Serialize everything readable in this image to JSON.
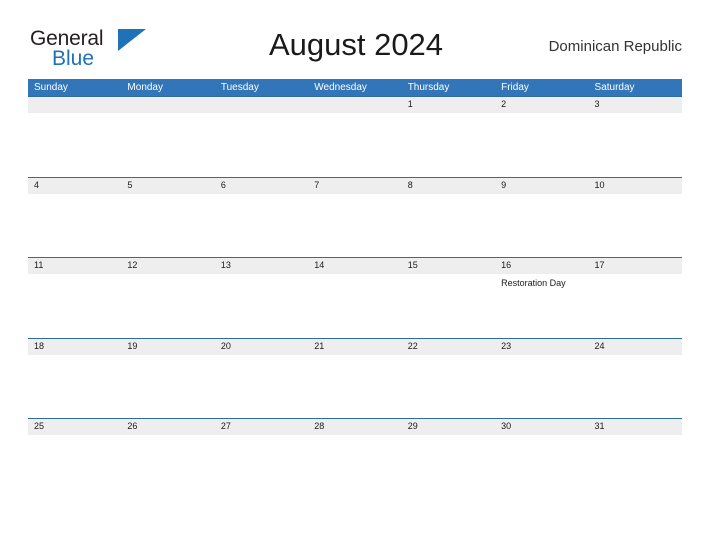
{
  "brand": {
    "line1": "General",
    "line2": "Blue",
    "flag_icon": "blue-flag-triangle-icon",
    "flag_color": "#1f72b8"
  },
  "header": {
    "title": "August 2024",
    "region": "Dominican Republic"
  },
  "colors": {
    "header_blue": "#3275b8",
    "row_border_blue": "#2e6da4",
    "daynum_band": "#eeeeee",
    "brand_blue": "#1f72b8",
    "page_background": "#ffffff"
  },
  "calendar": {
    "month": "August",
    "year": "2024",
    "weekdays": [
      "Sunday",
      "Monday",
      "Tuesday",
      "Wednesday",
      "Thursday",
      "Friday",
      "Saturday"
    ],
    "weeks": [
      {
        "days": [
          {
            "number": "",
            "events": []
          },
          {
            "number": "",
            "events": []
          },
          {
            "number": "",
            "events": []
          },
          {
            "number": "",
            "events": []
          },
          {
            "number": "1",
            "events": []
          },
          {
            "number": "2",
            "events": []
          },
          {
            "number": "3",
            "events": []
          }
        ]
      },
      {
        "days": [
          {
            "number": "4",
            "events": []
          },
          {
            "number": "5",
            "events": []
          },
          {
            "number": "6",
            "events": []
          },
          {
            "number": "7",
            "events": []
          },
          {
            "number": "8",
            "events": []
          },
          {
            "number": "9",
            "events": []
          },
          {
            "number": "10",
            "events": []
          }
        ]
      },
      {
        "days": [
          {
            "number": "11",
            "events": []
          },
          {
            "number": "12",
            "events": []
          },
          {
            "number": "13",
            "events": []
          },
          {
            "number": "14",
            "events": []
          },
          {
            "number": "15",
            "events": []
          },
          {
            "number": "16",
            "events": [
              "Restoration Day"
            ]
          },
          {
            "number": "17",
            "events": []
          }
        ]
      },
      {
        "days": [
          {
            "number": "18",
            "events": []
          },
          {
            "number": "19",
            "events": []
          },
          {
            "number": "20",
            "events": []
          },
          {
            "number": "21",
            "events": []
          },
          {
            "number": "22",
            "events": []
          },
          {
            "number": "23",
            "events": []
          },
          {
            "number": "24",
            "events": []
          }
        ]
      },
      {
        "days": [
          {
            "number": "25",
            "events": []
          },
          {
            "number": "26",
            "events": []
          },
          {
            "number": "27",
            "events": []
          },
          {
            "number": "28",
            "events": []
          },
          {
            "number": "29",
            "events": []
          },
          {
            "number": "30",
            "events": []
          },
          {
            "number": "31",
            "events": []
          }
        ]
      }
    ]
  }
}
